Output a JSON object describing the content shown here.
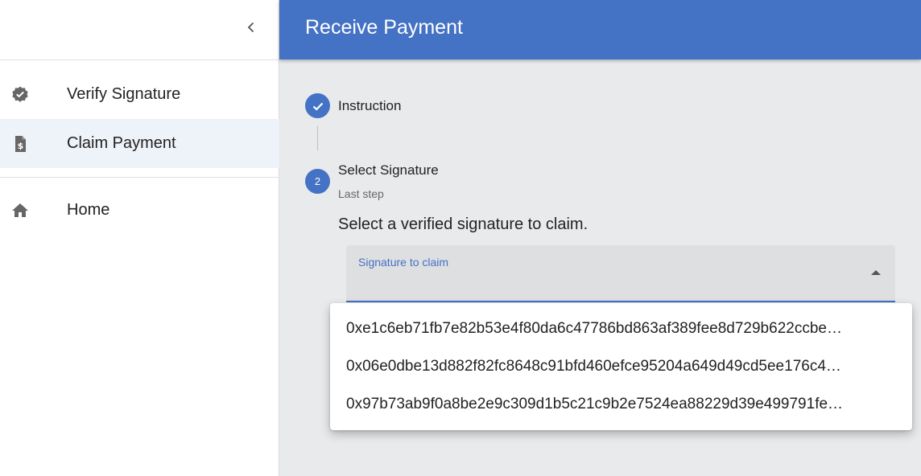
{
  "sidebar": {
    "items": [
      {
        "label": "Verify Signature",
        "icon": "verified-badge-icon",
        "active": false
      },
      {
        "label": "Claim Payment",
        "icon": "receipt-dollar-icon",
        "active": true
      },
      {
        "label": "Home",
        "icon": "home-icon",
        "active": false
      }
    ]
  },
  "appbar": {
    "title": "Receive Payment"
  },
  "stepper": {
    "steps": [
      {
        "label": "Instruction",
        "status": "completed",
        "index": ""
      },
      {
        "label": "Select Signature",
        "status": "active",
        "index": "2",
        "optional_text": "Last step"
      }
    ],
    "content_text": "Select a verified signature to claim."
  },
  "select": {
    "label": "Signature to claim",
    "value": ""
  },
  "dropdown": {
    "options": [
      "0xe1c6eb71fb7e82b53e4f80da6c47786bd863af389fee8d729b622ccbe…",
      "0x06e0dbe13d882f82fc8648c91bfd460efce95204a649d49cd5ee176c4…",
      "0x97b73ab9f0a8be2e9c309d1b5c21c9b2e7524ea88229d39e499791fe…"
    ]
  },
  "colors": {
    "primary": "#4472c4",
    "sidebar_active_bg": "#eef2f9",
    "content_bg": "#e9eaec"
  }
}
